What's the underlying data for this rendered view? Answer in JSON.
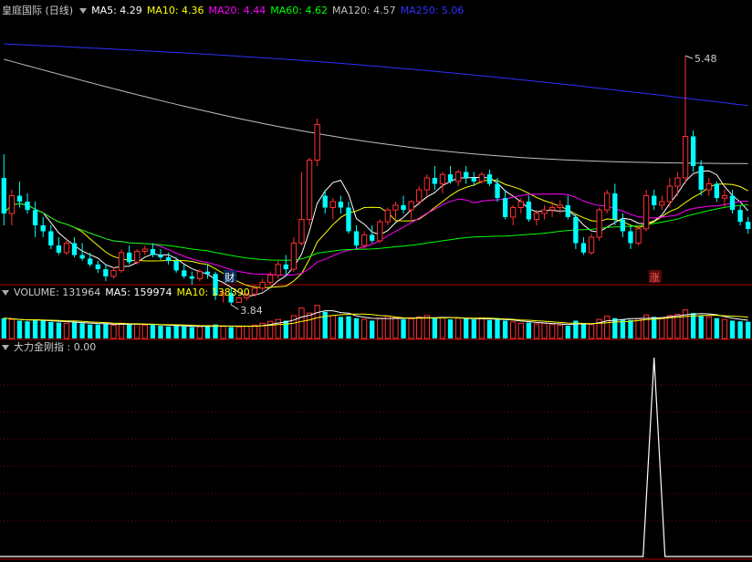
{
  "window": {
    "title": "皇庭国际 (日线)"
  },
  "price_panel": {
    "ma": [
      {
        "label": "MA5: 4.29",
        "color": "#ffffff"
      },
      {
        "label": "MA10: 4.36",
        "color": "#ffff00"
      },
      {
        "label": "MA20: 4.44",
        "color": "#ff00ff"
      },
      {
        "label": "MA60: 4.62",
        "color": "#00ff00"
      },
      {
        "label": "MA120: 4.57",
        "color": "#c0c0c0"
      },
      {
        "label": "MA250: 5.06",
        "color": "#3030ff"
      }
    ],
    "high_label": "5.48",
    "low_label": "3.84",
    "badge_cai": "财",
    "badge_zhang": "涨"
  },
  "volume_panel": {
    "title": "VOLUME: 131964",
    "ma5": "MA5: 159974",
    "ma10": "MA10: 138390"
  },
  "indicator_panel": {
    "title": "大力金刚指 : 0.00"
  },
  "colors": {
    "up": "#ff3030",
    "down": "#00ffff",
    "border": "#b40000",
    "grid": "#7a0000"
  },
  "chart_data": {
    "type": "candlestick",
    "period": "daily",
    "price_range": [
      3.55,
      5.75
    ],
    "candles": [
      [
        4.45,
        4.65,
        4.05,
        4.15
      ],
      [
        4.15,
        4.35,
        4.05,
        4.3
      ],
      [
        4.3,
        4.42,
        4.2,
        4.25
      ],
      [
        4.25,
        4.32,
        4.15,
        4.18
      ],
      [
        4.18,
        4.25,
        3.95,
        4.05
      ],
      [
        4.05,
        4.12,
        3.95,
        4.0
      ],
      [
        4.0,
        4.05,
        3.85,
        3.88
      ],
      [
        3.88,
        3.95,
        3.8,
        3.82
      ],
      [
        3.82,
        3.92,
        3.8,
        3.9
      ],
      [
        3.9,
        3.95,
        3.78,
        3.8
      ],
      [
        3.8,
        3.9,
        3.75,
        3.77
      ],
      [
        3.77,
        3.82,
        3.7,
        3.72
      ],
      [
        3.72,
        3.75,
        3.65,
        3.68
      ],
      [
        3.68,
        3.72,
        3.58,
        3.62
      ],
      [
        3.62,
        3.7,
        3.6,
        3.67
      ],
      [
        3.67,
        3.85,
        3.65,
        3.82
      ],
      [
        3.82,
        3.88,
        3.72,
        3.74
      ],
      [
        3.74,
        3.85,
        3.72,
        3.83
      ],
      [
        3.83,
        3.88,
        3.8,
        3.85
      ],
      [
        3.85,
        3.9,
        3.78,
        3.8
      ],
      [
        3.8,
        3.85,
        3.76,
        3.78
      ],
      [
        3.78,
        3.82,
        3.72,
        3.75
      ],
      [
        3.75,
        3.78,
        3.65,
        3.67
      ],
      [
        3.67,
        3.72,
        3.6,
        3.62
      ],
      [
        3.62,
        3.66,
        3.55,
        3.6
      ],
      [
        3.6,
        3.68,
        3.58,
        3.66
      ],
      [
        3.66,
        3.72,
        3.6,
        3.64
      ],
      [
        3.64,
        3.66,
        3.42,
        3.46
      ],
      [
        3.46,
        3.5,
        3.4,
        3.48
      ],
      [
        3.48,
        3.52,
        3.38,
        3.4
      ],
      [
        3.4,
        3.45,
        3.4,
        3.44
      ],
      [
        3.44,
        3.48,
        3.42,
        3.47
      ],
      [
        3.47,
        3.55,
        3.45,
        3.52
      ],
      [
        3.52,
        3.6,
        3.5,
        3.57
      ],
      [
        3.57,
        3.66,
        3.55,
        3.63
      ],
      [
        3.63,
        3.75,
        3.6,
        3.72
      ],
      [
        3.72,
        3.8,
        3.62,
        3.68
      ],
      [
        3.68,
        3.95,
        3.66,
        3.9
      ],
      [
        3.9,
        4.5,
        3.88,
        4.1
      ],
      [
        4.1,
        4.62,
        4.05,
        4.6
      ],
      [
        4.6,
        4.95,
        4.55,
        4.9
      ],
      [
        4.3,
        4.35,
        4.15,
        4.2
      ],
      [
        4.2,
        4.28,
        4.1,
        4.25
      ],
      [
        4.25,
        4.3,
        4.15,
        4.2
      ],
      [
        4.2,
        4.25,
        3.98,
        4.0
      ],
      [
        4.0,
        4.05,
        3.85,
        3.88
      ],
      [
        3.88,
        4.0,
        3.85,
        3.97
      ],
      [
        3.97,
        4.05,
        3.9,
        3.92
      ],
      [
        3.92,
        4.1,
        3.9,
        4.08
      ],
      [
        4.08,
        4.2,
        4.05,
        4.18
      ],
      [
        4.18,
        4.25,
        4.1,
        4.22
      ],
      [
        4.22,
        4.3,
        4.15,
        4.18
      ],
      [
        4.18,
        4.26,
        4.1,
        4.25
      ],
      [
        4.25,
        4.38,
        4.22,
        4.35
      ],
      [
        4.35,
        4.48,
        4.3,
        4.45
      ],
      [
        4.45,
        4.55,
        4.35,
        4.4
      ],
      [
        4.4,
        4.5,
        4.32,
        4.48
      ],
      [
        4.48,
        4.55,
        4.4,
        4.42
      ],
      [
        4.42,
        4.52,
        4.38,
        4.5
      ],
      [
        4.5,
        4.55,
        4.4,
        4.45
      ],
      [
        4.45,
        4.5,
        4.38,
        4.42
      ],
      [
        4.42,
        4.5,
        4.4,
        4.48
      ],
      [
        4.48,
        4.52,
        4.38,
        4.4
      ],
      [
        4.4,
        4.45,
        4.25,
        4.28
      ],
      [
        4.28,
        4.35,
        4.1,
        4.12
      ],
      [
        4.12,
        4.22,
        4.05,
        4.2
      ],
      [
        4.2,
        4.28,
        4.15,
        4.25
      ],
      [
        4.25,
        4.3,
        4.08,
        4.1
      ],
      [
        4.1,
        4.18,
        4.05,
        4.15
      ],
      [
        4.15,
        4.22,
        4.1,
        4.18
      ],
      [
        4.18,
        4.25,
        4.12,
        4.2
      ],
      [
        4.2,
        4.26,
        4.15,
        4.22
      ],
      [
        4.22,
        4.3,
        4.1,
        4.12
      ],
      [
        4.12,
        4.15,
        3.85,
        3.9
      ],
      [
        3.9,
        3.95,
        3.8,
        3.82
      ],
      [
        3.82,
        3.98,
        3.8,
        3.95
      ],
      [
        3.95,
        4.2,
        3.92,
        4.18
      ],
      [
        4.18,
        4.35,
        4.15,
        4.32
      ],
      [
        4.32,
        4.4,
        4.05,
        4.1
      ],
      [
        4.1,
        4.15,
        3.95,
        4.0
      ],
      [
        4.0,
        4.05,
        3.85,
        3.9
      ],
      [
        3.9,
        4.05,
        3.88,
        4.02
      ],
      [
        4.02,
        4.35,
        4.0,
        4.3
      ],
      [
        4.3,
        4.35,
        4.18,
        4.22
      ],
      [
        4.22,
        4.3,
        4.18,
        4.25
      ],
      [
        4.25,
        4.45,
        4.2,
        4.38
      ],
      [
        4.38,
        4.5,
        4.3,
        4.45
      ],
      [
        4.45,
        5.48,
        4.4,
        4.8
      ],
      [
        4.8,
        4.85,
        4.5,
        4.55
      ],
      [
        4.55,
        4.6,
        4.3,
        4.35
      ],
      [
        4.35,
        4.45,
        4.3,
        4.4
      ],
      [
        4.4,
        4.42,
        4.25,
        4.28
      ],
      [
        4.28,
        4.35,
        4.2,
        4.3
      ],
      [
        4.3,
        4.35,
        4.15,
        4.18
      ],
      [
        4.18,
        4.22,
        4.05,
        4.08
      ],
      [
        4.08,
        4.12,
        3.98,
        4.02
      ]
    ],
    "volume_range": [
      0,
      280000
    ],
    "volumes": [
      160000,
      150000,
      140000,
      135000,
      150000,
      140000,
      130000,
      125000,
      120000,
      130000,
      120000,
      110000,
      110000,
      115000,
      105000,
      120000,
      110000,
      115000,
      105000,
      110000,
      100000,
      95000,
      100000,
      95000,
      90000,
      95000,
      100000,
      110000,
      95000,
      90000,
      92000,
      98000,
      105000,
      120000,
      135000,
      150000,
      140000,
      180000,
      240000,
      200000,
      260000,
      210000,
      180000,
      170000,
      175000,
      160000,
      150000,
      140000,
      160000,
      175000,
      165000,
      150000,
      155000,
      170000,
      180000,
      160000,
      165000,
      150000,
      160000,
      155000,
      150000,
      160000,
      145000,
      150000,
      140000,
      130000,
      120000,
      125000,
      115000,
      120000,
      110000,
      105000,
      100000,
      140000,
      120000,
      110000,
      150000,
      175000,
      160000,
      150000,
      145000,
      155000,
      185000,
      170000,
      165000,
      180000,
      190000,
      225000,
      200000,
      180000,
      170000,
      160000,
      150000,
      140000,
      135000,
      131964
    ],
    "indicator_range": [
      0,
      1
    ],
    "indicator_signal_index": 83,
    "indicator_value": 0.0
  }
}
